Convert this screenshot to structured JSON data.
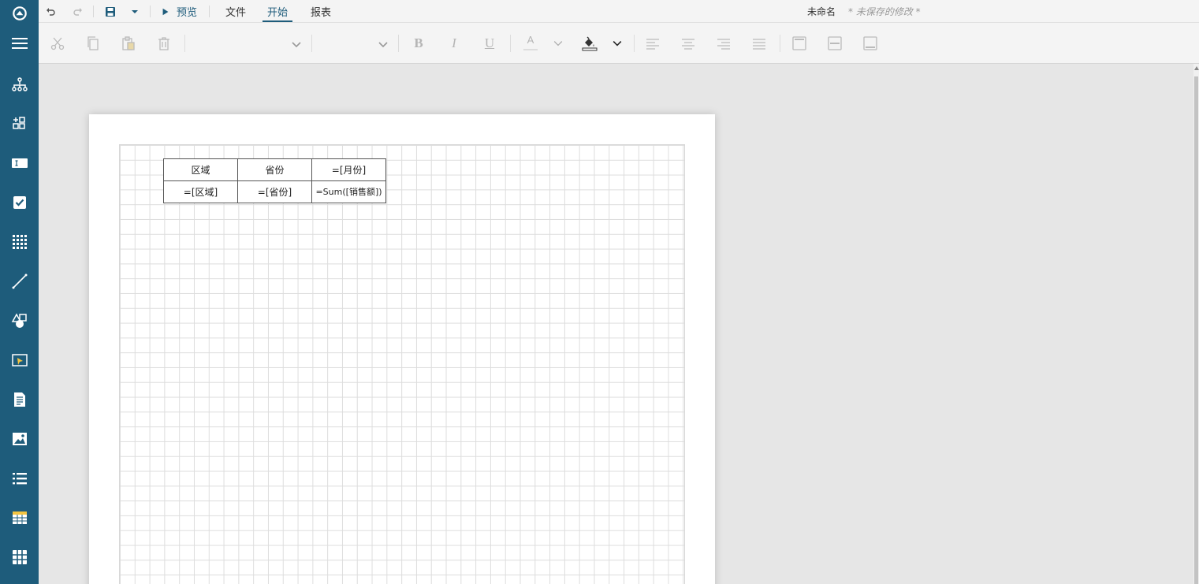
{
  "app": {
    "logo_icon": "circle-logo-icon",
    "colors": {
      "sidebar": "#1e5c7b",
      "accent": "#1e5c7b",
      "unsaved_text": "#999999"
    }
  },
  "sidebar": {
    "items": [
      {
        "name": "menu-icon"
      },
      {
        "name": "data-tree-icon"
      },
      {
        "name": "add-component-icon"
      },
      {
        "name": "textbox-icon"
      },
      {
        "name": "checkbox-icon"
      },
      {
        "name": "barcode-icon"
      },
      {
        "name": "line-icon"
      },
      {
        "name": "shapes-icon"
      },
      {
        "name": "input-field-icon"
      },
      {
        "name": "richtext-icon"
      },
      {
        "name": "image-icon"
      },
      {
        "name": "list-icon"
      },
      {
        "name": "table-icon"
      },
      {
        "name": "tablix-icon"
      }
    ]
  },
  "topbar": {
    "preview_label": "预览",
    "tabs": [
      {
        "label": "文件"
      },
      {
        "label": "开始"
      },
      {
        "label": "报表"
      }
    ],
    "active_tab": "开始",
    "document_title": "未命名",
    "unsaved_status": "* 未保存的修改 *"
  },
  "ribbon": {
    "font_family_value": "",
    "font_size_value": "",
    "bold_label": "B",
    "italic_label": "I",
    "underline_label": "U",
    "font_color_label": "A"
  },
  "report": {
    "header_row": [
      "区域",
      "省份",
      "=[月份]"
    ],
    "detail_row": [
      "=[区域]",
      "=[省份]",
      "=Sum([销售额])"
    ]
  }
}
